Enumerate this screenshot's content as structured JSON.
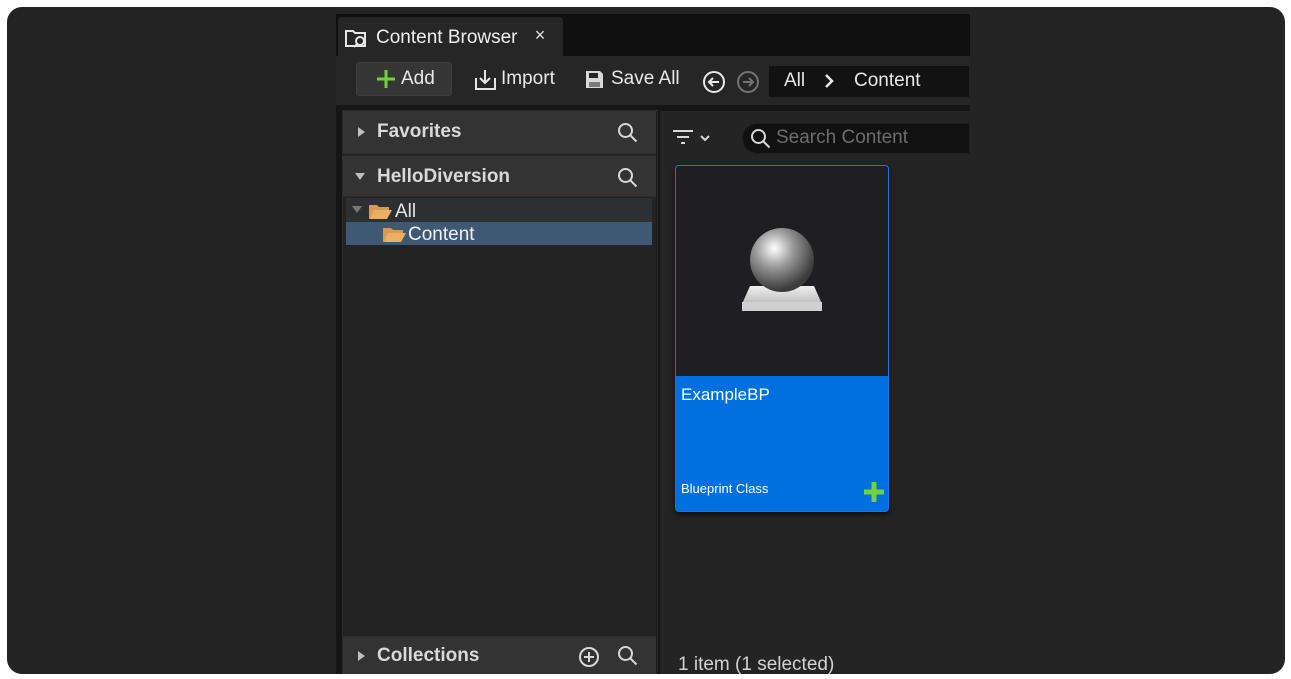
{
  "window": {
    "tab_title": "Content Browser",
    "tab_icon": "content-browser-icon",
    "close_icon": "close-icon"
  },
  "toolbar": {
    "add_label": "Add",
    "import_label": "Import",
    "save_all_label": "Save All",
    "icons": [
      "plus-icon",
      "import-icon",
      "save-icon",
      "back-arrow-icon",
      "forward-arrow-icon"
    ]
  },
  "breadcrumb": {
    "items": [
      "All",
      "Content"
    ],
    "separator_icon": "chevron-right-icon"
  },
  "sources": {
    "favorites": {
      "label": "Favorites",
      "expanded": false
    },
    "project": {
      "label": "HelloDiversion",
      "expanded": true
    },
    "tree": [
      {
        "label": "All",
        "expanded": true,
        "selected": false
      },
      {
        "label": "Content",
        "expanded": false,
        "selected": true
      }
    ],
    "collections": {
      "label": "Collections",
      "expanded": false
    }
  },
  "content": {
    "search": {
      "placeholder": "Search Content",
      "value": ""
    },
    "assets": [
      {
        "name": "ExampleBP",
        "type": "Blueprint Class",
        "selected": true,
        "thumbnail_icon": "blueprint-sphere-icon"
      }
    ],
    "status": "1 item (1 selected)"
  },
  "colors": {
    "accent_blue": "#0070e0",
    "selection_blue": "#3f5874",
    "add_green": "#6fd23c",
    "folder_orange": "#d59a55",
    "background": "#242424"
  }
}
